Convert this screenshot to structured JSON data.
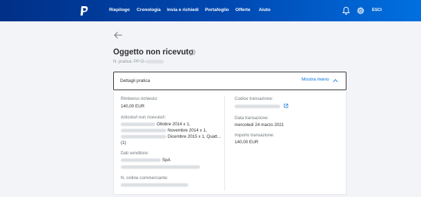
{
  "nav": {
    "items": [
      "Riepilogo",
      "Cronologia",
      "Invia e richiedi",
      "Portafoglio",
      "Offerte",
      "Aiuto"
    ],
    "logout": "ESCI"
  },
  "case": {
    "title": "Oggetto non ricevuto",
    "number_prefix": "N. pratica: PP-D-"
  },
  "panel": {
    "header": "Dettagli pratica",
    "toggle": "Mostra meno"
  },
  "left": {
    "refund_label": "Rimborso richiesto:",
    "refund_value": "140,00 EUR",
    "items_label": "Articolo/i non ricevuto/i:",
    "item1": "Ottobre 2014 x 1,",
    "item2": "Novembre 2014 x 1,",
    "item3": "Dicembre 2015 x 1, Quatt...",
    "item4": "(1)",
    "seller_label": "Dati venditore:",
    "seller_value": "SpA",
    "order_label": "N. ordine commerciante:"
  },
  "right": {
    "txn_code_label": "Codice transazione:",
    "txn_date_label": "Data transazione:",
    "txn_date_value": "mercoledì 24 marzo 2021",
    "txn_amount_label": "Importo transazione:",
    "txn_amount_value": "140,00 EUR"
  },
  "colors": {
    "nav_bg_start": "#003087",
    "nav_bg_end": "#0070e0",
    "link": "#0070e0"
  }
}
